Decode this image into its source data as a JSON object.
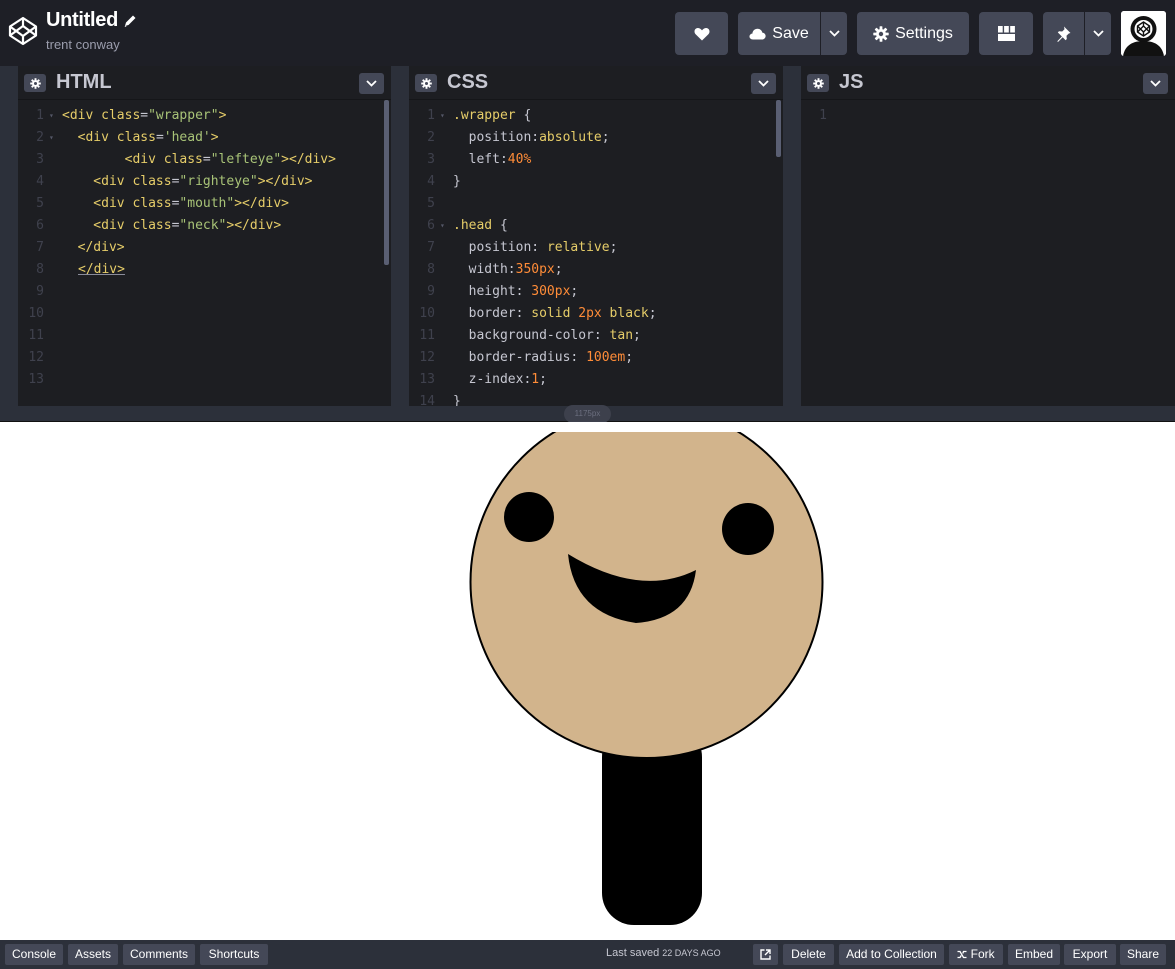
{
  "header": {
    "title": "Untitled",
    "author": "trent conway",
    "save_label": "Save",
    "settings_label": "Settings",
    "icons": {
      "logo": "codepen-logo-icon",
      "edit": "pencil-icon",
      "heart": "heart-icon",
      "save": "cloud-icon",
      "save_menu": "chevron-down-icon",
      "settings": "gear-icon",
      "layout": "layout-grid-icon",
      "pin": "pin-icon",
      "pin_menu": "chevron-down-icon"
    }
  },
  "panes": {
    "html": {
      "title": "HTML",
      "lines": [
        {
          "n": "1",
          "parts": [
            [
              "tag",
              "<div "
            ],
            [
              "attr",
              "class"
            ],
            [
              "punc",
              "="
            ],
            [
              "str",
              "\"wrapper\""
            ],
            [
              "tag",
              ">"
            ]
          ]
        },
        {
          "n": "2",
          "parts": [
            [
              "tag",
              "  <div "
            ],
            [
              "attr",
              "class"
            ],
            [
              "punc",
              "="
            ],
            [
              "str",
              "'head'"
            ],
            [
              "tag",
              ">"
            ]
          ]
        },
        {
          "n": "3",
          "parts": [
            [
              "tag",
              "        <div "
            ],
            [
              "attr",
              "class"
            ],
            [
              "punc",
              "="
            ],
            [
              "str",
              "\"lefteye\""
            ],
            [
              "tag",
              "></div>"
            ]
          ]
        },
        {
          "n": "4",
          "parts": [
            [
              "tag",
              "    <div "
            ],
            [
              "attr",
              "class"
            ],
            [
              "punc",
              "="
            ],
            [
              "str",
              "\"righteye\""
            ],
            [
              "tag",
              "></div>"
            ]
          ]
        },
        {
          "n": "5",
          "parts": [
            [
              "tag",
              "    <div "
            ],
            [
              "attr",
              "class"
            ],
            [
              "punc",
              "="
            ],
            [
              "str",
              "\"mouth\""
            ],
            [
              "tag",
              "></div>"
            ]
          ]
        },
        {
          "n": "6",
          "parts": [
            [
              "tag",
              "    <div "
            ],
            [
              "attr",
              "class"
            ],
            [
              "punc",
              "="
            ],
            [
              "str",
              "\"neck\""
            ],
            [
              "tag",
              "></div>"
            ]
          ]
        },
        {
          "n": "7",
          "parts": [
            [
              "tag",
              "  </div>"
            ]
          ]
        },
        {
          "n": "8",
          "parts": [
            [
              "tag",
              "  </div>"
            ]
          ]
        },
        {
          "n": "9",
          "parts": []
        },
        {
          "n": "10",
          "parts": []
        },
        {
          "n": "11",
          "parts": []
        },
        {
          "n": "12",
          "parts": []
        },
        {
          "n": "13",
          "parts": []
        }
      ]
    },
    "css": {
      "title": "CSS",
      "lines": [
        {
          "n": "1",
          "parts": [
            [
              "sel",
              ".wrapper"
            ],
            [
              "punc",
              " {"
            ]
          ]
        },
        {
          "n": "2",
          "parts": [
            [
              "prop",
              "  position"
            ],
            [
              "punc",
              ":"
            ],
            [
              "val",
              "absolute"
            ],
            [
              "punc",
              ";"
            ]
          ]
        },
        {
          "n": "3",
          "parts": [
            [
              "prop",
              "  left"
            ],
            [
              "punc",
              ":"
            ],
            [
              "num",
              "40%"
            ]
          ]
        },
        {
          "n": "4",
          "parts": [
            [
              "punc",
              "}"
            ]
          ]
        },
        {
          "n": "5",
          "parts": []
        },
        {
          "n": "6",
          "parts": [
            [
              "sel",
              ".head"
            ],
            [
              "punc",
              " {"
            ]
          ]
        },
        {
          "n": "7",
          "parts": [
            [
              "prop",
              "  position"
            ],
            [
              "punc",
              ": "
            ],
            [
              "val",
              "relative"
            ],
            [
              "punc",
              ";"
            ]
          ]
        },
        {
          "n": "8",
          "parts": [
            [
              "prop",
              "  width"
            ],
            [
              "punc",
              ":"
            ],
            [
              "num",
              "350px"
            ],
            [
              "punc",
              ";"
            ]
          ]
        },
        {
          "n": "9",
          "parts": [
            [
              "prop",
              "  height"
            ],
            [
              "punc",
              ": "
            ],
            [
              "num",
              "300px"
            ],
            [
              "punc",
              ";"
            ]
          ]
        },
        {
          "n": "10",
          "parts": [
            [
              "prop",
              "  border"
            ],
            [
              "punc",
              ": "
            ],
            [
              "val",
              "solid "
            ],
            [
              "num",
              "2px"
            ],
            [
              "val",
              " black"
            ],
            [
              "punc",
              ";"
            ]
          ]
        },
        {
          "n": "11",
          "parts": [
            [
              "prop",
              "  background-color"
            ],
            [
              "punc",
              ": "
            ],
            [
              "val",
              "tan"
            ],
            [
              "punc",
              ";"
            ]
          ]
        },
        {
          "n": "12",
          "parts": [
            [
              "prop",
              "  border-radius"
            ],
            [
              "punc",
              ": "
            ],
            [
              "num",
              "100em"
            ],
            [
              "punc",
              ";"
            ]
          ]
        },
        {
          "n": "13",
          "parts": [
            [
              "prop",
              "  z-index"
            ],
            [
              "punc",
              ":"
            ],
            [
              "num",
              "1"
            ],
            [
              "punc",
              ";"
            ]
          ]
        },
        {
          "n": "14",
          "parts": [
            [
              "punc",
              "}"
            ]
          ]
        }
      ]
    },
    "js": {
      "title": "JS",
      "lines": [
        {
          "n": "1",
          "parts": []
        }
      ]
    }
  },
  "resize": {
    "width_label": "1175px"
  },
  "preview": {
    "head_color": "#d2b48c",
    "neck_color": "#000000"
  },
  "footer": {
    "left_buttons": [
      "Console",
      "Assets",
      "Comments",
      "Shortcuts"
    ],
    "saved_prefix": "Last saved",
    "saved_ago": "22 DAYS AGO",
    "right_buttons": [
      "Delete",
      "Add to Collection",
      "Fork",
      "Embed",
      "Export",
      "Share"
    ]
  }
}
